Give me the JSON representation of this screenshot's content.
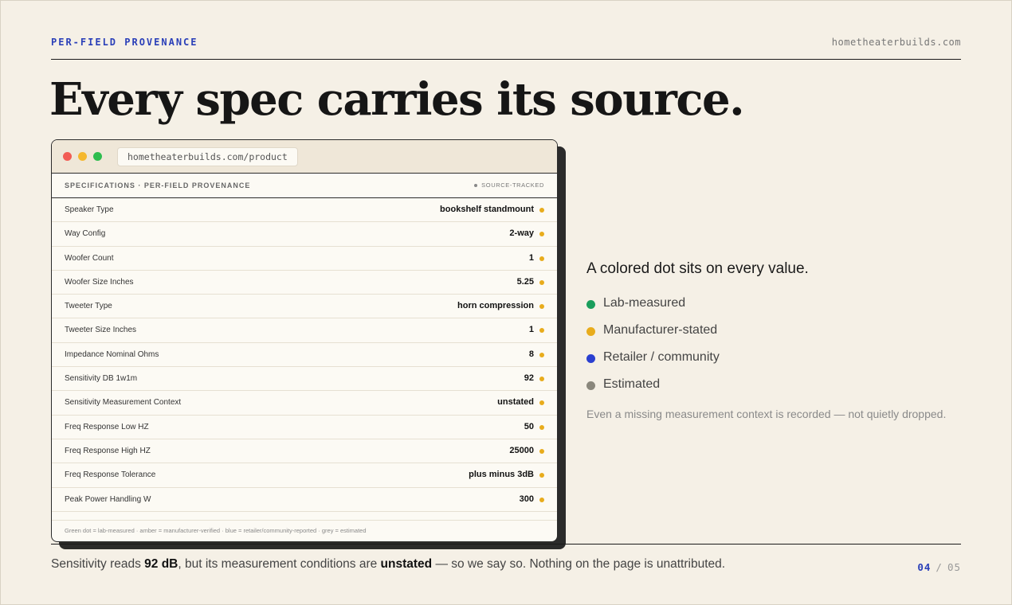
{
  "header": {
    "eyebrow": "PER-FIELD PROVENANCE",
    "site": "hometheaterbuilds.com",
    "headline": "Every spec carries its source."
  },
  "browser": {
    "url": "hometheaterbuilds.com/product",
    "spec_title": "SPECIFICATIONS · PER-FIELD PROVENANCE",
    "tracked_label": "SOURCE-TRACKED",
    "rows": [
      {
        "label": "Speaker Type",
        "value": "bookshelf standmount",
        "source": "manufacturer"
      },
      {
        "label": "Way Config",
        "value": "2-way",
        "source": "manufacturer"
      },
      {
        "label": "Woofer Count",
        "value": "1",
        "source": "manufacturer"
      },
      {
        "label": "Woofer Size Inches",
        "value": "5.25",
        "source": "manufacturer"
      },
      {
        "label": "Tweeter Type",
        "value": "horn compression",
        "source": "manufacturer"
      },
      {
        "label": "Tweeter Size Inches",
        "value": "1",
        "source": "manufacturer"
      },
      {
        "label": "Impedance Nominal Ohms",
        "value": "8",
        "source": "manufacturer"
      },
      {
        "label": "Sensitivity DB 1w1m",
        "value": "92",
        "source": "manufacturer"
      },
      {
        "label": "Sensitivity Measurement Context",
        "value": "unstated",
        "source": "manufacturer"
      },
      {
        "label": "Freq Response Low HZ",
        "value": "50",
        "source": "manufacturer"
      },
      {
        "label": "Freq Response High HZ",
        "value": "25000",
        "source": "manufacturer"
      },
      {
        "label": "Freq Response Tolerance",
        "value": "plus minus 3dB",
        "source": "manufacturer"
      },
      {
        "label": "Peak Power Handling W",
        "value": "300",
        "source": "manufacturer"
      }
    ],
    "footer_note": "Green dot = lab-measured · amber = manufacturer-verified · blue = retailer/community-reported · grey = estimated"
  },
  "legend": {
    "intro": "A colored dot sits on every value.",
    "items": [
      {
        "label": "Lab-measured",
        "color": "#1a9e5c"
      },
      {
        "label": "Manufacturer-stated",
        "color": "#e8ac1c"
      },
      {
        "label": "Retailer / community",
        "color": "#2a3fd0"
      },
      {
        "label": "Estimated",
        "color": "#8a877c"
      }
    ],
    "note": "Even a missing measurement context is recorded — not quietly dropped."
  },
  "source_colors": {
    "lab": "#1a9e5c",
    "manufacturer": "#e8ac1c",
    "retailer": "#2a3fd0",
    "estimated": "#8a877c"
  },
  "caption": {
    "part1": "Sensitivity reads ",
    "value": "92 dB",
    "part2": ", but its measurement conditions are ",
    "status": "unstated",
    "part3": " — so we say so. Nothing on the page is unattributed."
  },
  "pager": {
    "current": "04",
    "separator": "/",
    "total": "05"
  }
}
